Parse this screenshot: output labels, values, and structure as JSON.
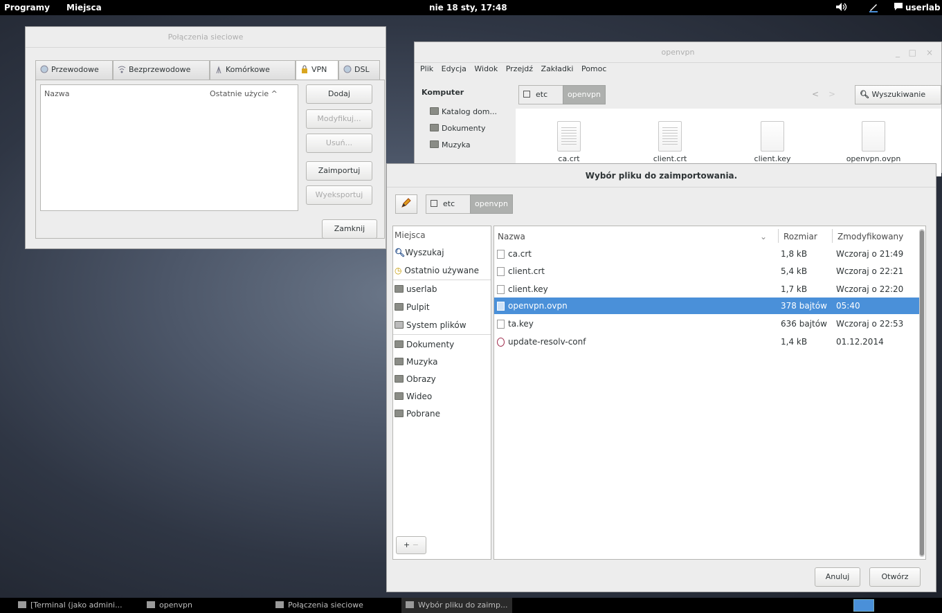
{
  "top_panel": {
    "programs": "Programy",
    "places": "Miejsca",
    "clock": "nie 18 sty, 17:48",
    "user": "userlab"
  },
  "net_window": {
    "title": "Połączenia sieciowe",
    "tabs": [
      "Przewodowe",
      "Bezprzewodowe",
      "Komórkowe",
      "VPN",
      "DSL"
    ],
    "col_name": "Nazwa",
    "col_last_used": "Ostatnie użycie ^",
    "buttons": {
      "add": "Dodaj",
      "modify": "Modyfikuj...",
      "delete": "Usuń...",
      "import": "Zaimportuj",
      "export": "Wyeksportuj",
      "close": "Zamknij"
    }
  },
  "naut_window": {
    "title": "openvpn",
    "controls": [
      "_",
      "□",
      "×"
    ],
    "menu": [
      "Plik",
      "Edycja",
      "Widok",
      "Przejdź",
      "Zakładki",
      "Pomoc"
    ],
    "sidebar_title": "Komputer",
    "sidebar": [
      "Katalog dom...",
      "Dokumenty",
      "Muzyka"
    ],
    "path": [
      "etc",
      "openvpn"
    ],
    "search": "Wyszukiwanie",
    "files": [
      "ca.crt",
      "client.crt",
      "client.key",
      "openvpn.ovpn"
    ]
  },
  "chooser": {
    "title": "Wybór pliku do zaimportowania.",
    "path": [
      "etc",
      "openvpn"
    ],
    "places_header": "Miejsca",
    "places": [
      "Wyszukaj",
      "Ostatnio używane",
      "userlab",
      "Pulpit",
      "System plików",
      "Dokumenty",
      "Muzyka",
      "Obrazy",
      "Wideo",
      "Pobrane"
    ],
    "col_name": "Nazwa",
    "col_size": "Rozmiar",
    "col_modified": "Zmodyfikowany",
    "files": [
      {
        "name": "ca.crt",
        "size": "1,8 kB",
        "modified": "Wczoraj o 21:49"
      },
      {
        "name": "client.crt",
        "size": "5,4 kB",
        "modified": "Wczoraj o 22:21"
      },
      {
        "name": "client.key",
        "size": "1,7 kB",
        "modified": "Wczoraj o 22:20"
      },
      {
        "name": "openvpn.ovpn",
        "size": "378 bajtów",
        "modified": "05:40"
      },
      {
        "name": "ta.key",
        "size": "636 bajtów",
        "modified": "Wczoraj o 22:53"
      },
      {
        "name": "update-resolv-conf",
        "size": "1,4 kB",
        "modified": "01.12.2014"
      }
    ],
    "add_btn": "+",
    "remove_btn": "−",
    "cancel": "Anuluj",
    "open": "Otwórz"
  },
  "taskbar": [
    "[Terminal (jako admini...",
    "openvpn",
    "Połączenia sieciowe",
    "Wybór pliku do zaimp..."
  ],
  "colors": {
    "selection": "#4a90d9",
    "panel": "#000000"
  }
}
